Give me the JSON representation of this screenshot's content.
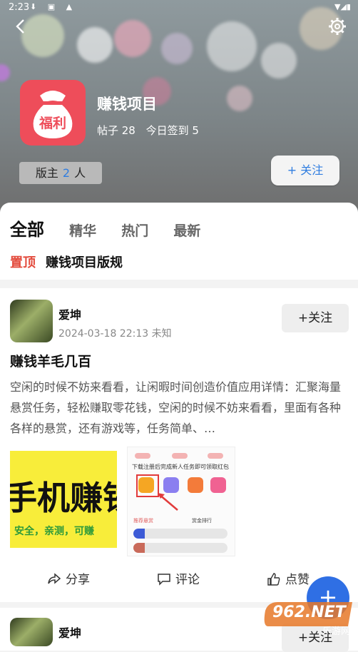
{
  "status": {
    "time": "2:23"
  },
  "forum": {
    "title": "赚钱项目",
    "posts_label": "帖子 28",
    "signin_label": "今日签到 5",
    "logo_text": "福利",
    "moderators": {
      "prefix": "版主",
      "count": "2",
      "suffix": "人"
    },
    "follow_label": "+ 关注"
  },
  "tabs": [
    "全部",
    "精华",
    "热门",
    "最新"
  ],
  "pinned": {
    "tag": "置顶",
    "title": "赚钱项目版规"
  },
  "post": {
    "author": "爱坤",
    "meta": "2024-03-18 22:13 未知",
    "follow_label": "+关注",
    "title": "赚钱羊毛几百",
    "body": "空闲的时候不妨来看看，让闲暇时间创造价值应用详情：汇聚海量悬赏任务，轻松赚取零花钱，空闲的时候不妨来看看，里面有各种各样的悬赏，还有游戏等，任务简单、…",
    "image1": {
      "big": "手机赚钱",
      "small": "安全，亲测，可赚"
    },
    "image2": {
      "heading": "下载注册后完成新人任务即可领取红包",
      "left_label": "推荐悬赏",
      "right_label": "赏金排行"
    },
    "actions": {
      "share": "分享",
      "comment": "评论",
      "like": "点赞"
    }
  },
  "post2": {
    "author": "爱坤",
    "follow_label": "+关注"
  },
  "fab": "+",
  "watermark": {
    "text": "962.NET",
    "sub": "乐游网"
  },
  "colors": {
    "accent": "#2f7de0",
    "pinned": "#e34b3d",
    "fab": "#2f6fe4",
    "logo": "#ee4d5a"
  }
}
